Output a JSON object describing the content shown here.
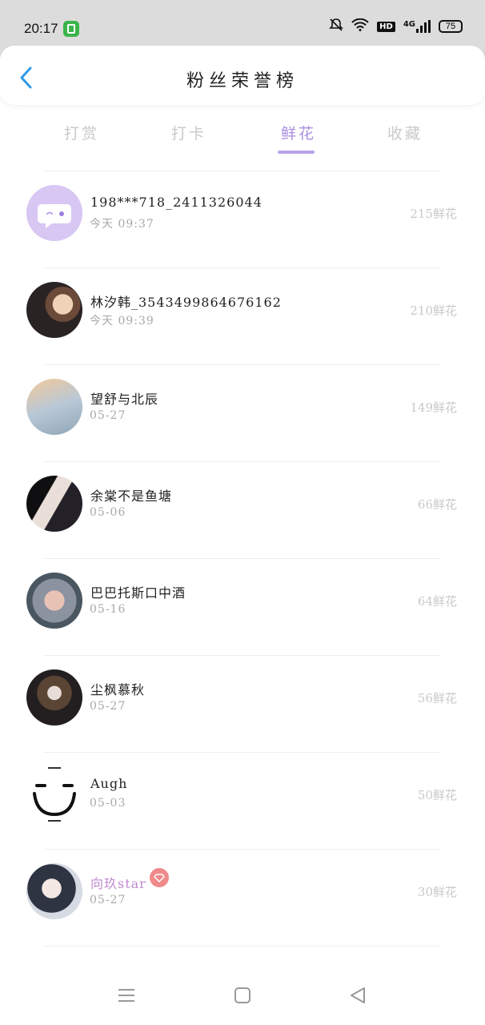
{
  "status_bar": {
    "time": "20:17",
    "network": "4G",
    "hd": "HD",
    "battery": "75"
  },
  "header": {
    "title": "粉丝荣誉榜"
  },
  "tabs": [
    {
      "label": "打赏",
      "active": false
    },
    {
      "label": "打卡",
      "active": false
    },
    {
      "label": "鲜花",
      "active": true
    },
    {
      "label": "收藏",
      "active": false
    }
  ],
  "rows": [
    {
      "name": "198***718_2411326044",
      "date": "今天 09:37",
      "amount": "215鲜花"
    },
    {
      "name": "林汐韩_3543499864676162",
      "date": "今天 09:39",
      "amount": "210鲜花"
    },
    {
      "name": "望舒与北辰",
      "date": "05-27",
      "amount": "149鲜花"
    },
    {
      "name": "余棠不是鱼塘",
      "date": "05-06",
      "amount": "66鲜花"
    },
    {
      "name": "巴巴托斯口中酒",
      "date": "05-16",
      "amount": "64鲜花"
    },
    {
      "name": "尘枫慕秋",
      "date": "05-27",
      "amount": "56鲜花"
    },
    {
      "name": "Augh",
      "date": "05-03",
      "amount": "50鲜花"
    },
    {
      "name": "向玖star",
      "date": "05-27",
      "amount": "30鲜花"
    }
  ],
  "colors": {
    "accent": "#a98fe0",
    "back": "#2f9be8",
    "vip_name": "#c08bd0",
    "vip_badge": "#f08a8a"
  }
}
